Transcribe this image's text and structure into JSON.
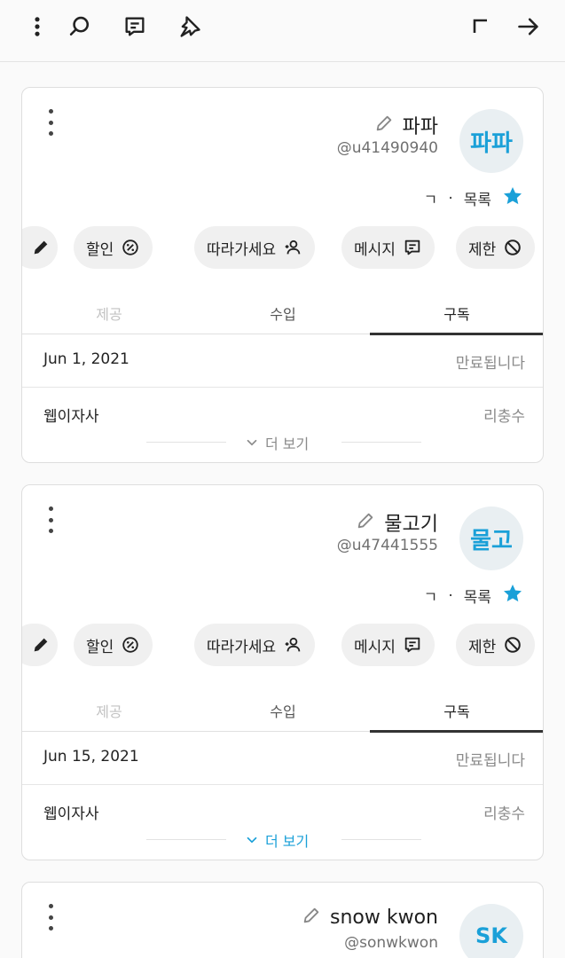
{
  "topbar": {
    "icons": [
      "more-vertical-icon",
      "search-icon",
      "message-icon",
      "pin-icon",
      "corner-icon",
      "arrow-icon"
    ]
  },
  "actions": {
    "block": "제한",
    "message": "메시지",
    "follow": "따라가세요",
    "discount": "할인"
  },
  "tabs": [
    "구독",
    "수입",
    "제공"
  ],
  "cards": [
    {
      "avatar": "파파",
      "name": "파파",
      "handle": "@u41490940",
      "list_label": "목록",
      "list_extra": "ㄱ",
      "rows": [
        {
          "label": "만료됩니다",
          "value": "Jun 1, 2021"
        },
        {
          "label": "리충수",
          "value": "웹이자사"
        }
      ],
      "more": "더 보기"
    },
    {
      "avatar": "물고",
      "name": "물고기",
      "handle": "@u47441555",
      "list_label": "목록",
      "list_extra": "ㄱ",
      "rows": [
        {
          "label": "만료됩니다",
          "value": "Jun 15, 2021"
        },
        {
          "label": "리충수",
          "value": "웹이자사"
        }
      ],
      "more": "더 보기"
    },
    {
      "avatar": "SK",
      "name": "snow kwon",
      "handle": "@sonwkwon"
    }
  ],
  "colors": {
    "accent": "#1aa0d8",
    "avatar_bg": "#e9eff2",
    "chip_bg": "#f0f0f0"
  }
}
